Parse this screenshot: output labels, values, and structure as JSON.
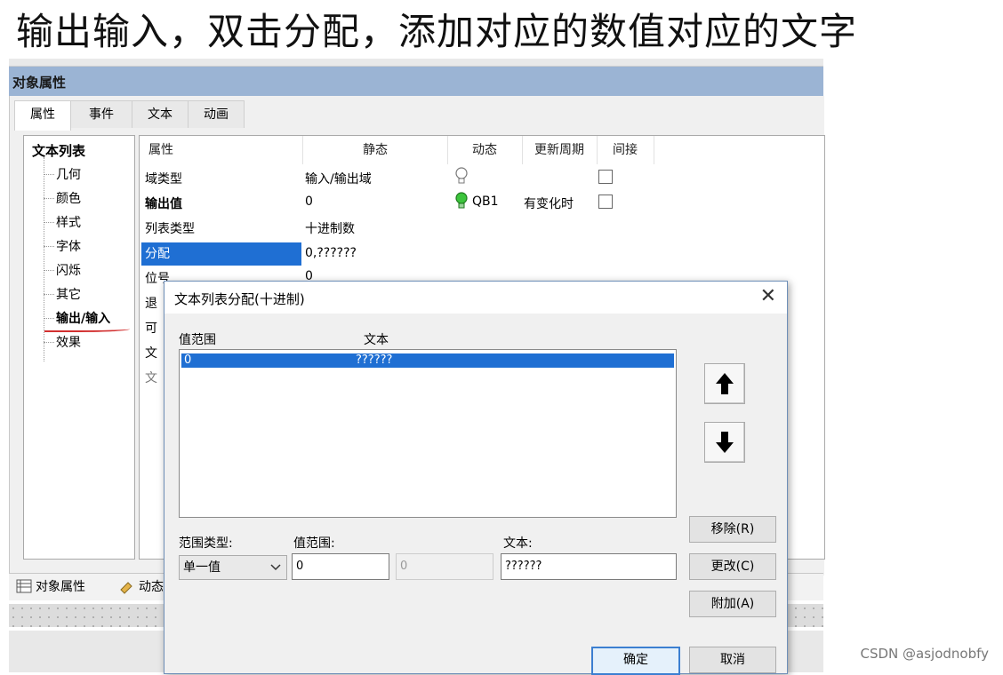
{
  "caption": "输出输入，双击分配，添加对应的数值对应的文字",
  "window": {
    "title": "对象属性"
  },
  "tabs": [
    "属性",
    "事件",
    "文本",
    "动画"
  ],
  "tree": {
    "title": "文本列表",
    "items": [
      "几何",
      "颜色",
      "样式",
      "字体",
      "闪烁",
      "其它",
      "输出/输入",
      "效果"
    ],
    "selected": "输出/输入"
  },
  "grid": {
    "headers": [
      "属性",
      "静态",
      "动态",
      "更新周期",
      "间接"
    ],
    "rows": [
      {
        "name": "域类型",
        "static": "输入/输出域",
        "dynamic": "",
        "cycle": ""
      },
      {
        "name": "输出值",
        "static": "0",
        "dynamic": "QB1",
        "cycle": "有变化时"
      },
      {
        "name": "列表类型",
        "static": "十进制数",
        "dynamic": "",
        "cycle": ""
      },
      {
        "name": "分配",
        "static": "0,??????",
        "dynamic": "",
        "cycle": ""
      },
      {
        "name": "位号",
        "static": "0",
        "dynamic": "",
        "cycle": ""
      }
    ],
    "partial_rows": [
      "退",
      "可",
      "文",
      "文"
    ]
  },
  "bottom_tabs": [
    "对象属性",
    "动态"
  ],
  "dialog": {
    "title": "文本列表分配(十进制)",
    "list_headers": [
      "值范围",
      "文本"
    ],
    "list_rows": [
      {
        "range": "0",
        "text": "??????"
      }
    ],
    "range_type_label": "范围类型:",
    "range_type_value": "单一值",
    "value_range_label": "值范围:",
    "value_from": "0",
    "value_to": "0",
    "text_label": "文本:",
    "text_value": "??????",
    "buttons": {
      "remove": "移除(R)",
      "change": "更改(C)",
      "append": "附加(A)",
      "ok": "确定",
      "cancel": "取消"
    }
  },
  "watermark": "CSDN @asjodnobfy",
  "colors": {
    "titlebar": "#9bb4d4",
    "selection": "#1f6fd3",
    "annotation": "#d23030"
  }
}
